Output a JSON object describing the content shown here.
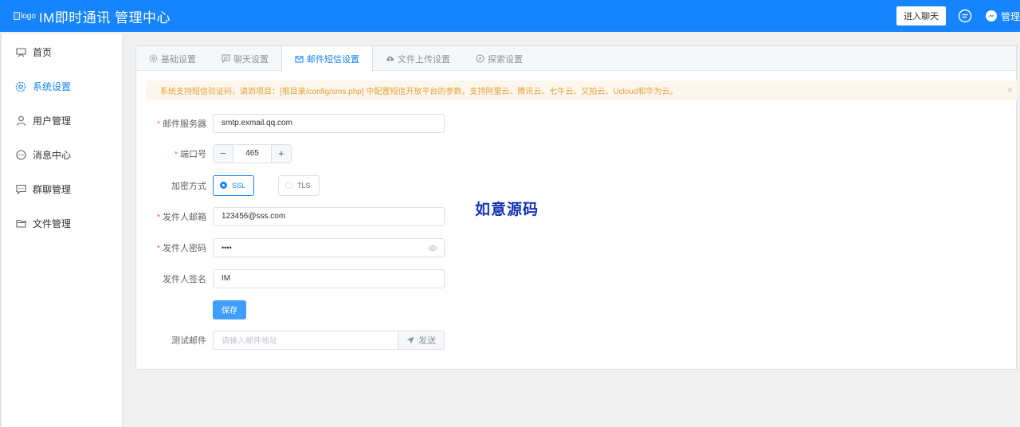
{
  "header": {
    "logo_alt": "logo",
    "title": "IM即时通讯 管理中心",
    "enter_chat_label": "进入聊天",
    "user_label": "管理"
  },
  "sidebar": {
    "items": [
      {
        "label": "首页",
        "icon": "dashboard-icon"
      },
      {
        "label": "系统设置",
        "icon": "gear-icon",
        "active": true
      },
      {
        "label": "用户管理",
        "icon": "user-icon"
      },
      {
        "label": "消息中心",
        "icon": "message-icon"
      },
      {
        "label": "群聊管理",
        "icon": "group-chat-icon"
      },
      {
        "label": "文件管理",
        "icon": "folder-icon"
      }
    ]
  },
  "tabs": [
    {
      "label": "基础设置",
      "icon": "gear-icon"
    },
    {
      "label": "聊天设置",
      "icon": "chat-icon"
    },
    {
      "label": "邮件短信设置",
      "icon": "mail-icon",
      "active": true
    },
    {
      "label": "文件上传设置",
      "icon": "cloud-upload-icon"
    },
    {
      "label": "探索设置",
      "icon": "compass-icon"
    }
  ],
  "alert": {
    "text": "系统支持短信验证码，请到项目：[根目录/config/sms.php] 中配置短信开放平台的参数，支持阿里云、腾讯云、七牛云、又拍云、Ucloud和华为云。"
  },
  "form": {
    "mail_server": {
      "label": "邮件服务器",
      "value": "smtp.exmail.qq.com",
      "required": true
    },
    "port": {
      "label": "端口号",
      "value": "465",
      "required": true
    },
    "encryption": {
      "label": "加密方式",
      "options": [
        "SSL",
        "TLS"
      ],
      "selected": "SSL"
    },
    "sender_email": {
      "label": "发件人邮箱",
      "value": "123456@sss.com",
      "required": true
    },
    "sender_password": {
      "label": "发件人密码",
      "value": "••••",
      "required": true
    },
    "sender_signature": {
      "label": "发件人签名",
      "value": "IM"
    },
    "save_label": "保存",
    "test_mail": {
      "label": "测试邮件",
      "placeholder": "请输入邮件地址",
      "send_label": "发送"
    }
  },
  "watermark": "如意源码",
  "colors": {
    "primary": "#1684fc",
    "warning": "#e6a23c",
    "required": "#f56c6c"
  }
}
